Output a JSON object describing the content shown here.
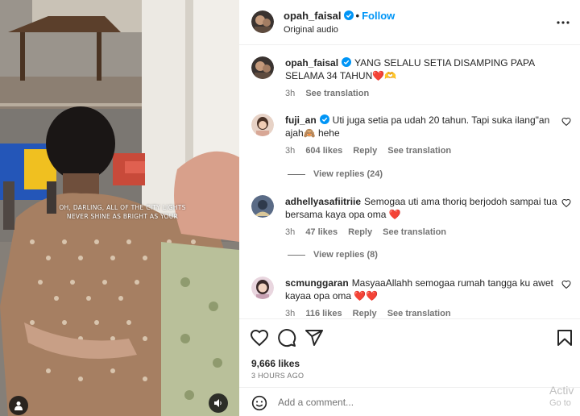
{
  "media": {
    "overlay_text": "OH, DARLING, ALL OF THE CITY LIGHTS NEVER SHINE AS BRIGHT AS YOUR",
    "user_tag_icon": "person-icon",
    "mute_icon": "speaker-icon"
  },
  "header": {
    "username": "opah_faisal",
    "separator": "•",
    "follow_label": "Follow",
    "audio_label": "Original audio",
    "more_icon": "more-horizontal-icon"
  },
  "caption": {
    "username": "opah_faisal",
    "text": "YANG SELALU SETIA DISAMPING PAPA SELAMA 34 TAHUN❤️🫶",
    "time": "3h",
    "see_translation": "See translation"
  },
  "comments": [
    {
      "username": "fuji_an",
      "verified": true,
      "text": "Uti juga setia pa udah 20 tahun. Tapi suka ilang\"an ajah🙈 hehe",
      "time": "3h",
      "likes": "604 likes",
      "reply": "Reply",
      "see_translation": "See translation",
      "view_replies": "View replies (24)"
    },
    {
      "username": "adhellyasafiitriie",
      "verified": false,
      "text": "Semogaa uti ama thoriq berjodoh sampai tua bersama kaya opa oma ❤️",
      "time": "3h",
      "likes": "47 likes",
      "reply": "Reply",
      "see_translation": "See translation",
      "view_replies": "View replies (8)"
    },
    {
      "username": "scmunggaran",
      "verified": false,
      "text": "MasyaaAllahh semogaa rumah tangga ku awet kayaa opa oma ❤️❤️",
      "time": "3h",
      "likes": "116 likes",
      "reply": "Reply",
      "see_translation": "See translation"
    }
  ],
  "actions": {
    "likes": "9,666 likes",
    "time_ago": "3 HOURS AGO",
    "comment_placeholder": "Add a comment...",
    "icons": [
      "heart-icon",
      "comment-icon",
      "share-icon",
      "bookmark-icon",
      "emoji-icon"
    ]
  },
  "watermark": {
    "line1": "Activ",
    "line2": "Go to"
  },
  "colors": {
    "accent": "#0095f6",
    "verified": "#0095f6",
    "heart": "#e0245e",
    "secondary_text": "#737373"
  }
}
